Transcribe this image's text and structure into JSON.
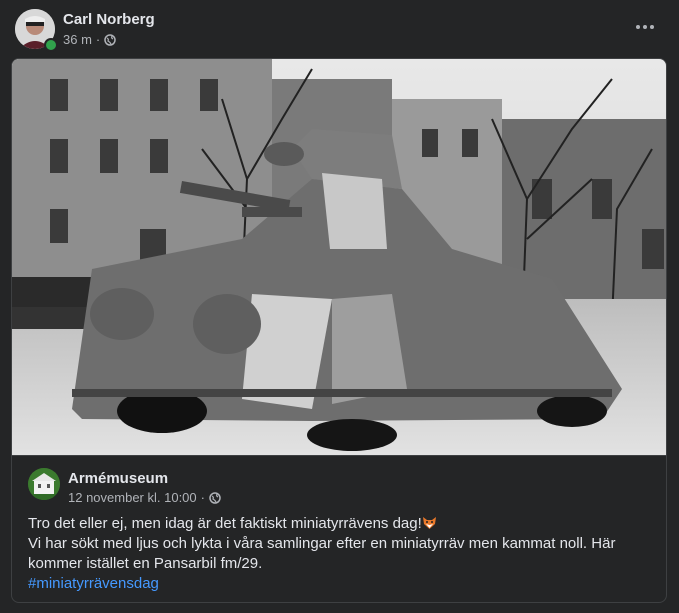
{
  "post": {
    "author": "Carl Norberg",
    "time": "36 m",
    "separator": "·",
    "privacy_icon": "globe-icon",
    "more_icon": "more-options-icon"
  },
  "shared": {
    "photo_description_icon": "armored-car-photo",
    "page_name": "Armémuseum",
    "date": "12 november kl. 10:00",
    "separator": "·",
    "text_line1": "Tro det eller ej, men idag är det faktiskt miniatyrrävens dag!",
    "emoji": "fox-face-icon",
    "text_line2": "Vi har sökt med ljus och lykta i våra samlingar efter en miniatyrräv men kammat noll. Här kommer istället en Pansarbil fm/29.",
    "hashtag": "#miniatyrrävensdag"
  },
  "colors": {
    "background": "#242526",
    "text_primary": "#e4e6eb",
    "text_secondary": "#b0b3b8",
    "link": "#4599ff",
    "online": "#31a24c"
  }
}
